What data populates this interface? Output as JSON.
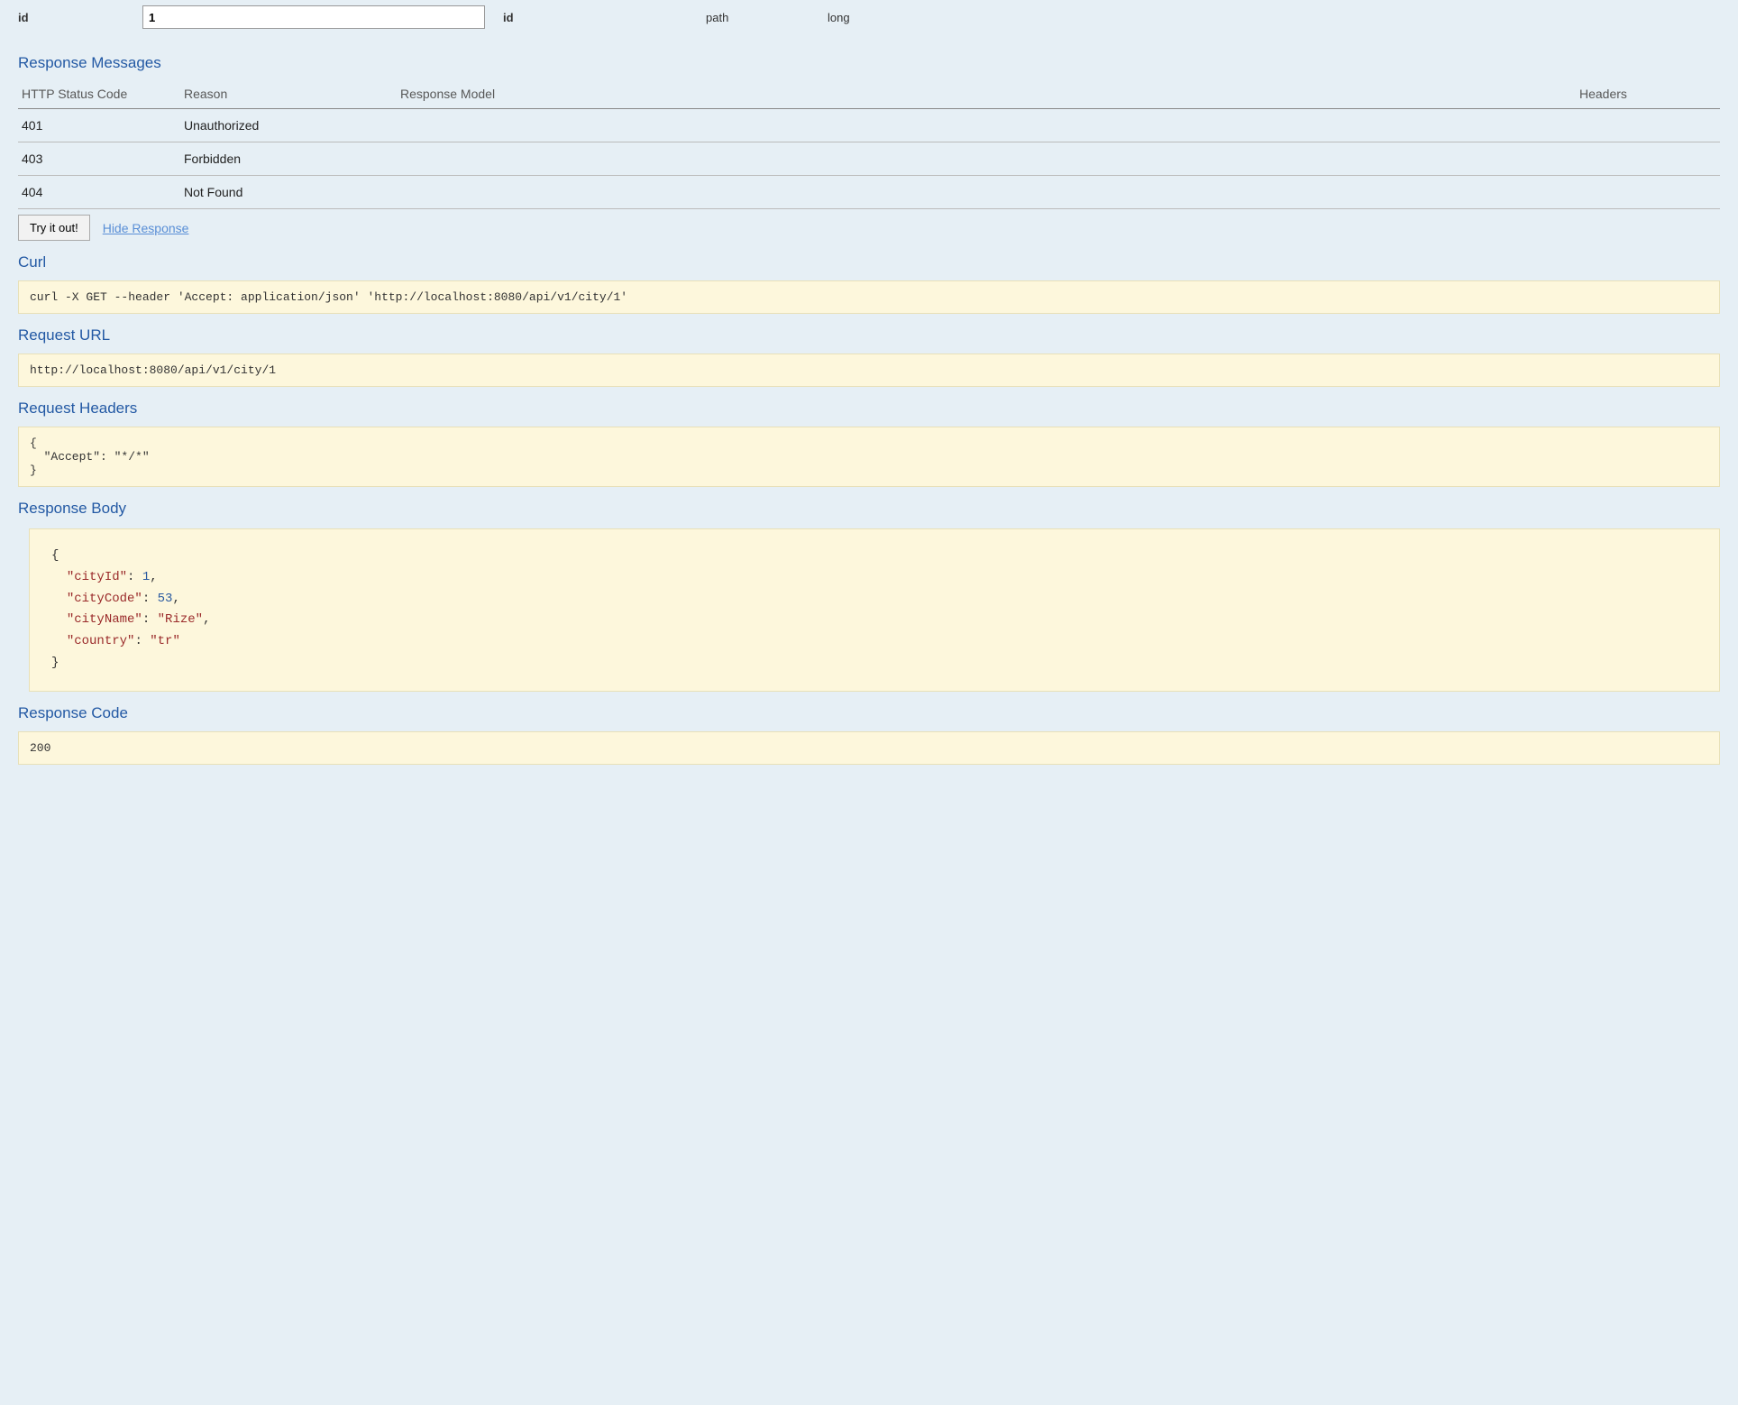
{
  "param": {
    "name": "id",
    "value": "1",
    "description": "id",
    "param_type": "path",
    "data_type": "long"
  },
  "sections": {
    "response_messages": "Response Messages",
    "curl": "Curl",
    "request_url": "Request URL",
    "request_headers": "Request Headers",
    "response_body": "Response Body",
    "response_code": "Response Code"
  },
  "response_messages_headers": {
    "code": "HTTP Status Code",
    "reason": "Reason",
    "model": "Response Model",
    "headers": "Headers"
  },
  "response_messages": [
    {
      "code": "401",
      "reason": "Unauthorized"
    },
    {
      "code": "403",
      "reason": "Forbidden"
    },
    {
      "code": "404",
      "reason": "Not Found"
    }
  ],
  "actions": {
    "try_it": "Try it out!",
    "hide_response": "Hide Response"
  },
  "curl_command": "curl -X GET --header 'Accept: application/json' 'http://localhost:8080/api/v1/city/1'",
  "request_url": "http://localhost:8080/api/v1/city/1",
  "request_headers": "{\n  \"Accept\": \"*/*\"\n}",
  "response_body_json": {
    "cityId": 1,
    "cityCode": 53,
    "cityName": "Rize",
    "country": "tr"
  },
  "response_code": "200"
}
